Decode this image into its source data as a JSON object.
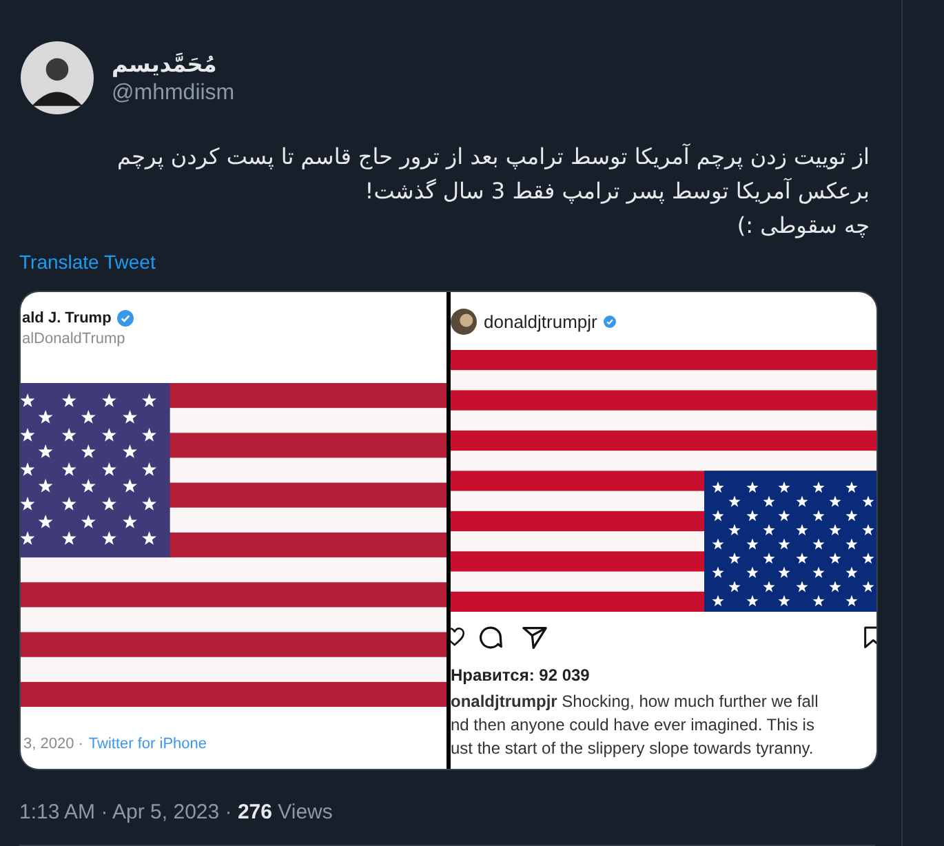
{
  "tweet": {
    "name": "مُحَمَّدیسم",
    "handle": "@mhmdiism",
    "text": "از توییت زدن پرچم آمریکا توسط ترامپ بعد از ترور حاج قاسم تا پست کردن پرچم\nبرعکس آمریکا توسط پسر ترامپ فقط 3 سال گذشت!\nچه سقوطی :)",
    "translate": "Translate Tweet",
    "media": [
      {
        "kind": "tweet",
        "name": "ald J. Trump",
        "verified": true,
        "handle": "alDonaldTrump",
        "inverted": false,
        "footer_date": "3, 2020 ·",
        "footer_source": "Twitter for iPhone"
      },
      {
        "kind": "post",
        "name": "donaldjtrumpjr",
        "verified": true,
        "inverted": true,
        "likes": "Нравится: 92 039",
        "caption": "**onaldjtrumpjr** Shocking, how much further we fall\nnd then anyone could have ever imagined. This is\nust the start of the slippery slope towards tyranny."
      }
    ],
    "footer": "1:13 AM · Apr 5, 2023 · **276** Views"
  }
}
